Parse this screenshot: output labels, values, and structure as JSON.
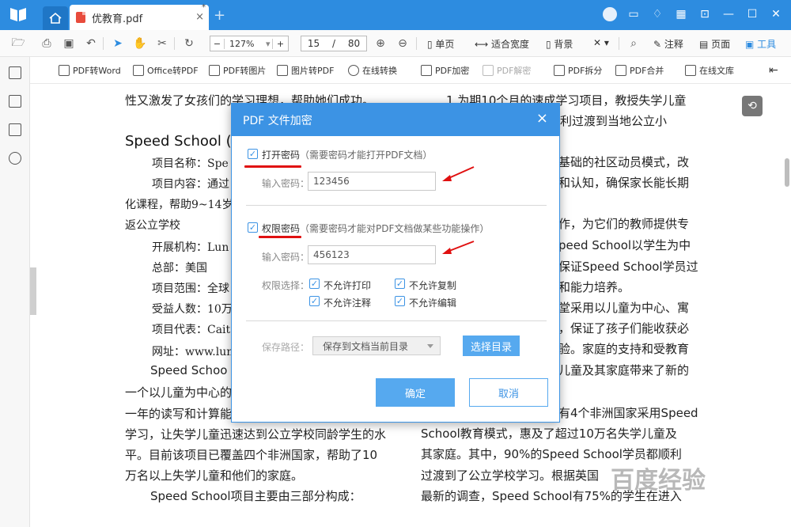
{
  "titlebar": {
    "tab_title": "优教育.pdf",
    "tab_modified": "*",
    "tab_close": "×",
    "new_tab": "+"
  },
  "toolbar": {
    "zoom_minus": "−",
    "zoom_value": "127%",
    "zoom_plus": "+",
    "page_current": "15",
    "page_separator": "/",
    "page_total": "80",
    "single_page": "单页",
    "fit_width": "适合宽度",
    "background": "背景",
    "annotate": "注释",
    "page": "页面",
    "tools": "工具"
  },
  "funcbar": {
    "items": [
      "PDF转Word",
      "Office转PDF",
      "PDF转图片",
      "图片转PDF",
      "在线转换",
      "PDF加密",
      "PDF解密",
      "PDF拆分",
      "PDF合并",
      "在线文库"
    ]
  },
  "document": {
    "left": [
      "性又激发了女孩们的学习理想，帮助她们成功。",
      "Speed School (",
      "项目名称：Spe",
      "项目内容：通过",
      "化课程，帮助9~14岁",
      "返公立学校",
      "开展机构：Lun",
      "总部：美国",
      "项目范围：全球",
      "受益人数：10万",
      "项目代表：Cait",
      "网址：www.lun",
      "Speed Schoo",
      "一个以儿童为中心的",
      "一年的读写和计算能",
      "学习，让失学儿童迅速达到公立学校同龄学生的水",
      "平。目前该项目已覆盖四个非洲国家，帮助了10",
      "万名以上失学儿童和他们的家庭。",
      "Speed School项目主要由三部分构成："
    ],
    "right": [
      "1.为期10个月的速成学习项目，教授失学儿童",
      "们顺利过渡到当地公立小",
      "基础的社区动员模式，改",
      "和认知，确保家长能长期",
      "作，为它们的教师提供专",
      "peed School以学生为中",
      "保证Speed School学员过",
      "和能力培养。",
      "堂采用以儿童为中心、寓",
      "，保证了孩子们能收获必",
      "验。家庭的支持和受教育",
      "儿童及其家庭带来了新的",
      "有4个非洲国家采用Speed",
      "School教育模式，惠及了超过10万名失学儿童及",
      "其家庭。其中，90%的Speed School学员都顺利",
      "过渡到了公立学校学习。根据英国",
      "最新的调查，Speed School有75%的学生在进入"
    ]
  },
  "dialog": {
    "title": "PDF 文件加密",
    "close": "×",
    "open_pw_label": "打开密码",
    "open_pw_hint": "（需要密码才能打开PDF文档）",
    "input_label_1": "输入密码：",
    "open_pw_value": "123456",
    "perm_pw_label": "权限密码",
    "perm_pw_hint": "（需要密码才能对PDF文档做某些功能操作）",
    "input_label_2": "输入密码：",
    "perm_pw_value": "456123",
    "perm_select_label": "权限选择：",
    "perm_no_print": "不允许打印",
    "perm_no_copy": "不允许复制",
    "perm_no_annot": "不允许注释",
    "perm_no_edit": "不允许编辑",
    "save_path_label": "保存路径：",
    "save_path_value": "保存到文档当前目录",
    "choose_dir": "选择目录",
    "ok": "确定",
    "cancel": "取消"
  },
  "watermark": "百度经验",
  "colors": {
    "accent": "#2d8ce0",
    "dialog_header": "#3c93e4",
    "annotation_red": "#e01010"
  }
}
